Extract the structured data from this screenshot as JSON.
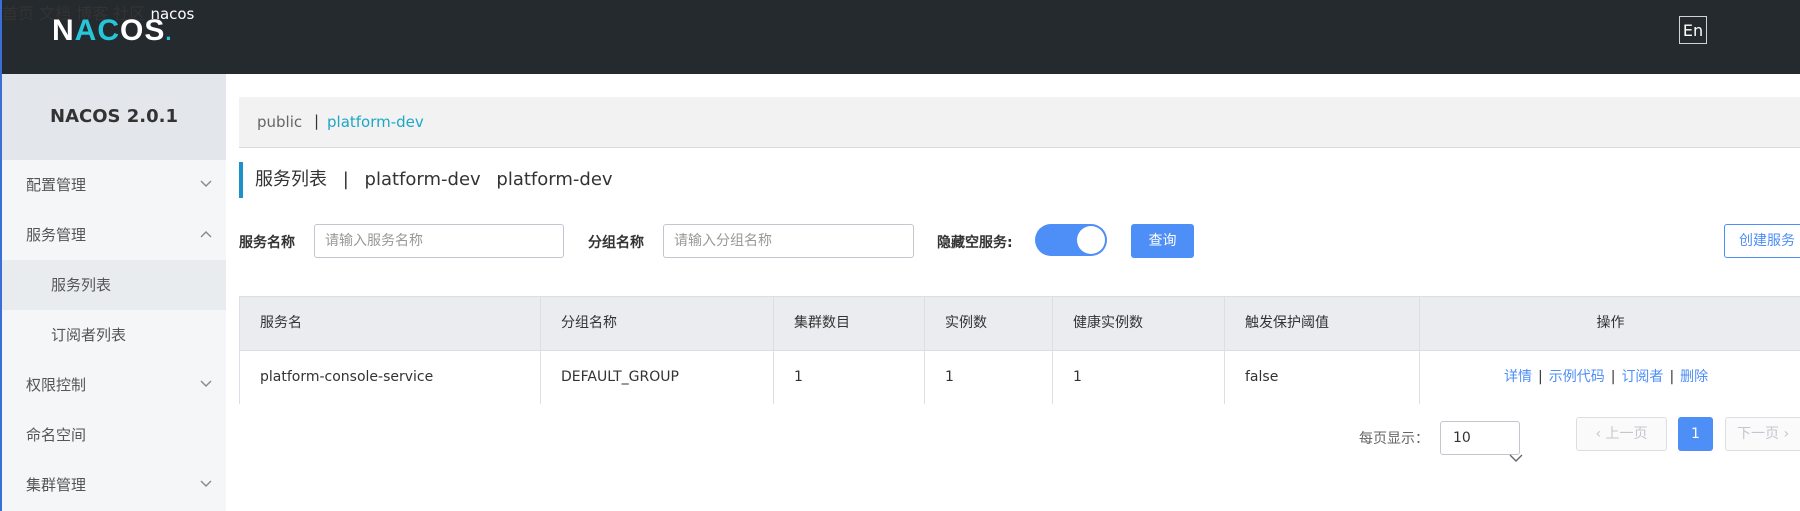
{
  "header": {
    "logo_text": "NACOS.",
    "nav": [
      "首页",
      "文档",
      "博客",
      "社区"
    ],
    "lang_button": "En",
    "user": "nacos"
  },
  "sidebar": {
    "title": "NACOS 2.0.1",
    "items": [
      {
        "label": "配置管理",
        "expanded": false
      },
      {
        "label": "服务管理",
        "expanded": true
      },
      {
        "label": "服务列表",
        "sub": true,
        "active": true
      },
      {
        "label": "订阅者列表",
        "sub": true
      },
      {
        "label": "权限控制",
        "expanded": false
      },
      {
        "label": "命名空间"
      },
      {
        "label": "集群管理",
        "expanded": false
      }
    ]
  },
  "namespaces": {
    "items": [
      "public",
      "platform-dev"
    ],
    "separator": "|",
    "active": "platform-dev"
  },
  "page": {
    "title": "服务列表",
    "separator": "|",
    "namespace_name": "platform-dev",
    "namespace_id": "platform-dev"
  },
  "filters": {
    "service_name_label": "服务名称",
    "service_name_placeholder": "请输入服务名称",
    "group_name_label": "分组名称",
    "group_name_placeholder": "请输入分组名称",
    "hide_empty_label": "隐藏空服务:",
    "hide_empty_on": true,
    "query_button": "查询",
    "create_button": "创建服务"
  },
  "table": {
    "columns": [
      "服务名",
      "分组名称",
      "集群数目",
      "实例数",
      "健康实例数",
      "触发保护阈值",
      "操作"
    ],
    "rows": [
      {
        "service_name": "platform-console-service",
        "group_name": "DEFAULT_GROUP",
        "cluster_count": "1",
        "instance_count": "1",
        "healthy_instance_count": "1",
        "protect_threshold": "false",
        "actions": [
          "详情",
          "示例代码",
          "订阅者",
          "删除"
        ]
      }
    ]
  },
  "pagination": {
    "page_size_label": "每页显示：",
    "page_size": "10",
    "prev": "上一页",
    "current_page": "1",
    "next": "下一页"
  },
  "colors": {
    "header_bg": "#252a2f",
    "primary": "#4e8ef7",
    "accent": "#1ea7c5"
  }
}
